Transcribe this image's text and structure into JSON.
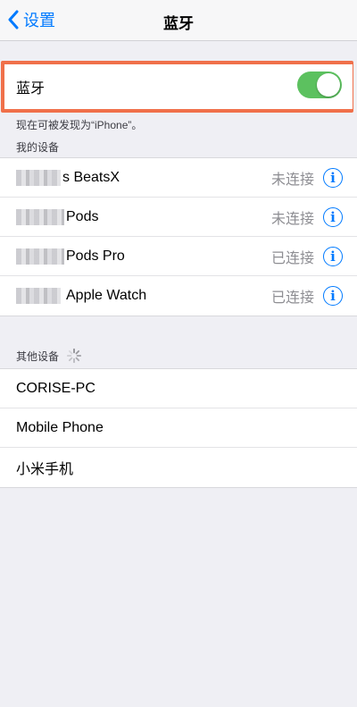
{
  "navbar": {
    "back_label": "设置",
    "title": "蓝牙"
  },
  "bluetooth": {
    "label": "蓝牙",
    "enabled": true,
    "note": "现在可被发现为“iPhone”。"
  },
  "my_devices": {
    "header": "我的设备",
    "items": [
      {
        "name": "s BeatsX",
        "status": "未连接"
      },
      {
        "name": "Pods",
        "status": "未连接"
      },
      {
        "name": "Pods Pro",
        "status": "已连接"
      },
      {
        "name": "Apple Watch",
        "status": "已连接"
      }
    ]
  },
  "other_devices": {
    "header": "其他设备",
    "items": [
      {
        "name": "CORISE-PC"
      },
      {
        "name": "Mobile Phone"
      },
      {
        "name": "小米手机"
      }
    ]
  },
  "colors": {
    "accent": "#007aff",
    "toggle_on": "#5cc15f",
    "highlight": "#f0704a"
  }
}
